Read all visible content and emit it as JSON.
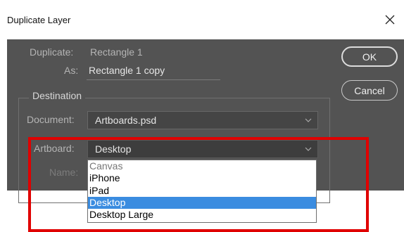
{
  "window": {
    "title": "Duplicate Layer",
    "close_icon": "close-icon"
  },
  "duplicate": {
    "label": "Duplicate:",
    "value": "Rectangle 1"
  },
  "as": {
    "label": "As:",
    "value": "Rectangle 1 copy"
  },
  "buttons": {
    "ok": "OK",
    "cancel": "Cancel"
  },
  "destination": {
    "legend": "Destination",
    "document_label": "Document:",
    "document_value": "Artboards.psd",
    "artboard_label": "Artboard:",
    "artboard_value": "Desktop",
    "name_label": "Name:"
  },
  "artboard_options": [
    "Canvas",
    "iPhone",
    "iPad",
    "Desktop",
    "Desktop Large"
  ],
  "artboard_selected_index": 3,
  "colors": {
    "dialog_bg": "#535353",
    "highlight": "#e00000",
    "selection": "#3a8ce0"
  }
}
